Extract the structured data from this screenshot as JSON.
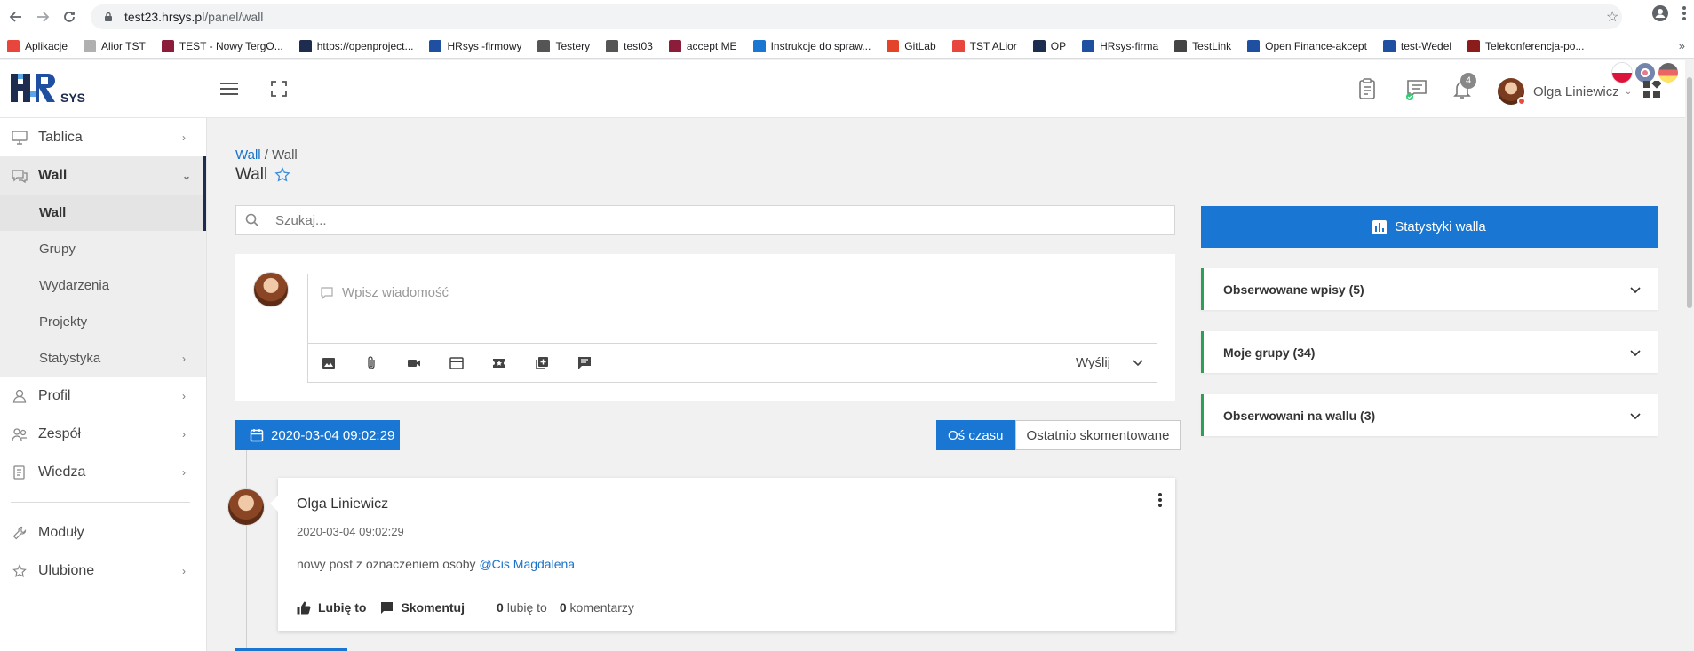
{
  "browser": {
    "url_host": "test23.hrsys.pl",
    "url_path": "/panel/wall",
    "bookmarks": [
      {
        "label": "Aplikacje",
        "color": "#e8453c"
      },
      {
        "label": "Alior TST",
        "color": "#b0b0b0"
      },
      {
        "label": "TEST - Nowy TergO...",
        "color": "#8b1c3a"
      },
      {
        "label": "https://openproject...",
        "color": "#1e2c4f"
      },
      {
        "label": "HRsys -firmowy",
        "color": "#1e4fa0"
      },
      {
        "label": "Testery",
        "color": "#555555"
      },
      {
        "label": "test03",
        "color": "#555555"
      },
      {
        "label": "accept ME",
        "color": "#8b1c3a"
      },
      {
        "label": "Instrukcje do spraw...",
        "color": "#1976d2"
      },
      {
        "label": "GitLab",
        "color": "#e24329"
      },
      {
        "label": "TST ALior",
        "color": "#e8453c"
      },
      {
        "label": "OP",
        "color": "#1e2c4f"
      },
      {
        "label": "HRsys-firma",
        "color": "#1e4fa0"
      },
      {
        "label": "TestLink",
        "color": "#444444"
      },
      {
        "label": "Open Finance-akcept",
        "color": "#1e4fa0"
      },
      {
        "label": "test-Wedel",
        "color": "#1e4fa0"
      },
      {
        "label": "Telekonferencja-po...",
        "color": "#8b1c1c"
      }
    ],
    "more": "»"
  },
  "header": {
    "logo_text": "SYS",
    "notification_count": "4",
    "user_name": "Olga Liniewicz"
  },
  "sidebar": {
    "items": [
      {
        "label": "Tablica",
        "icon": "monitor-icon"
      },
      {
        "label": "Wall",
        "icon": "chat-icon"
      },
      {
        "label": "Profil",
        "icon": "user-icon"
      },
      {
        "label": "Zespół",
        "icon": "team-icon"
      },
      {
        "label": "Wiedza",
        "icon": "book-icon"
      },
      {
        "label": "Moduły",
        "icon": "wrench-icon"
      },
      {
        "label": "Ulubione",
        "icon": "star-icon"
      }
    ],
    "sub": [
      "Wall",
      "Grupy",
      "Wydarzenia",
      "Projekty",
      "Statystyka"
    ]
  },
  "main": {
    "breadcrumb_link": "Wall",
    "breadcrumb_sep": " / ",
    "breadcrumb_current": "Wall",
    "title": "Wall",
    "search_placeholder": "Szukaj...",
    "composer_placeholder": "Wpisz wiadomość",
    "send_label": "Wyślij",
    "date_pill": "2020-03-04 09:02:29",
    "toggle_on": "Oś czasu",
    "toggle_off": "Ostatnio skomentowane"
  },
  "post": {
    "author": "Olga Liniewicz",
    "time": "2020-03-04 09:02:29",
    "text": "nowy post z oznaczeniem osoby ",
    "mention": "@Cis Magdalena",
    "like_label": "Lubię to",
    "comment_label": "Skomentuj",
    "likes_count": "0",
    "likes_text": " lubię to",
    "comments_count": "0",
    "comments_text": " komentarzy"
  },
  "right": {
    "stats_label": "Statystyki walla",
    "panels": [
      "Obserwowane wpisy (5)",
      "Moje grupy (34)",
      "Obserwowani na wallu (3)"
    ]
  },
  "colors": {
    "accent": "#1976d2",
    "panel_border": "#2e9f55",
    "sidebar_indicator": "#1e2c4f"
  }
}
